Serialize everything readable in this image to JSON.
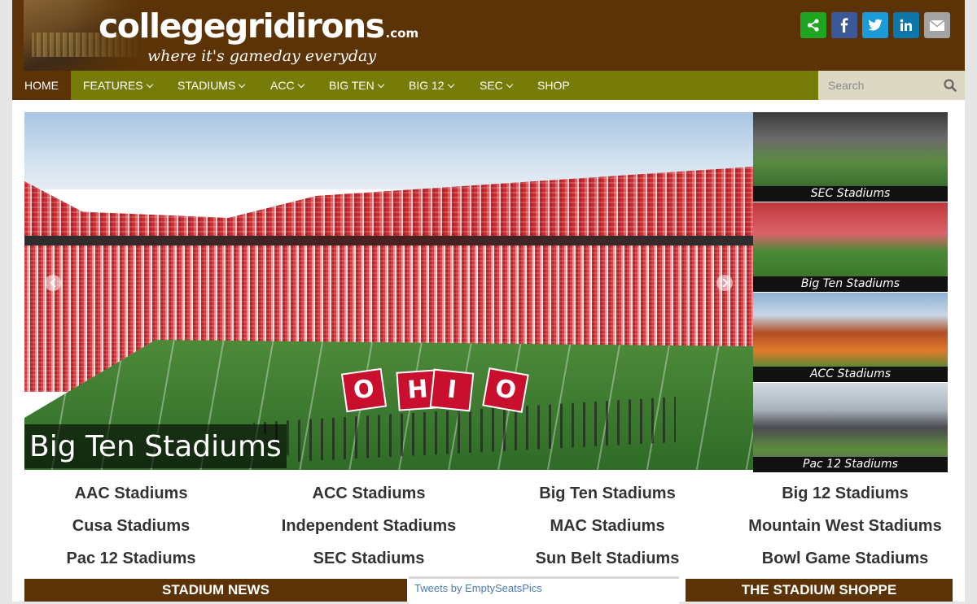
{
  "header": {
    "logo_text": "collegegridirons",
    "logo_suffix": ".com",
    "tagline": "where it's gameday everyday",
    "social": [
      {
        "icon": "share-icon",
        "color": "#1fa51f"
      },
      {
        "icon": "facebook-icon",
        "color": "#3b5998"
      },
      {
        "icon": "twitter-icon",
        "color": "#1d9bd8"
      },
      {
        "icon": "linkedin-icon",
        "color": "#0e76a8"
      },
      {
        "icon": "email-icon",
        "color": "#a3a3a3"
      }
    ]
  },
  "nav": {
    "items": [
      "HOME",
      "FEATURES",
      "STADIUMS",
      "ACC",
      "BIG TEN",
      "BIG 12",
      "SEC",
      "SHOP"
    ],
    "search_placeholder": "Search"
  },
  "slider": {
    "caption": "Big Ten Stadiums",
    "flags": [
      "O",
      "H",
      "I",
      "O"
    ]
  },
  "thumbnails": [
    "SEC Stadiums",
    "Big Ten Stadiums",
    "ACC Stadiums",
    "Pac 12 Stadiums"
  ],
  "conferences": [
    [
      "AAC Stadiums",
      "ACC Stadiums",
      "Big Ten Stadiums",
      "Big 12 Stadiums"
    ],
    [
      "Cusa Stadiums",
      "Independent Stadiums",
      "MAC Stadiums",
      "Mountain West Stadiums"
    ],
    [
      "Pac 12 Stadiums",
      "SEC Stadiums",
      "Sun Belt Stadiums",
      "Bowl Game Stadiums"
    ]
  ],
  "bottom": {
    "news_title": "STADIUM NEWS",
    "tweets_link": "Tweets by EmptySeatsPics",
    "shop_title": "THE STADIUM SHOPPE"
  },
  "colors": {
    "header_brown": "#5b3306",
    "nav_olive": "#777c08",
    "search_bg": "#ddd8c4"
  }
}
